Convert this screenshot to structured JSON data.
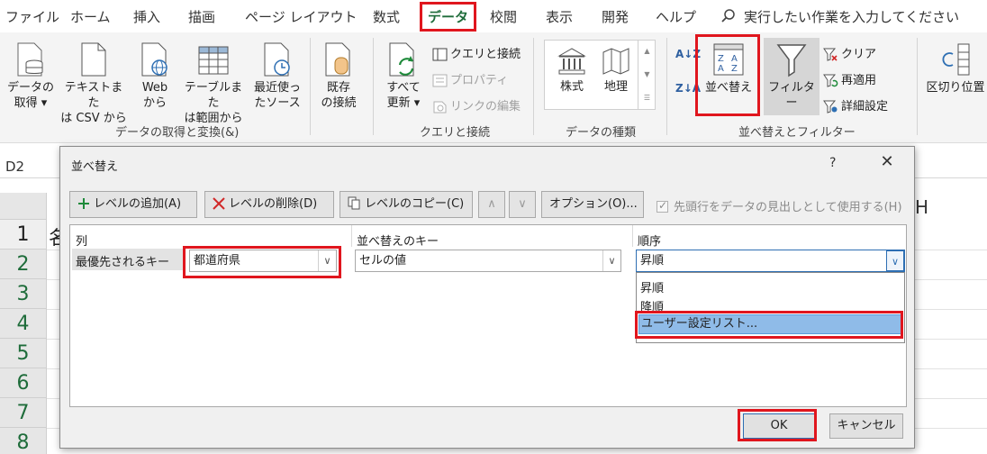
{
  "ribbon_tabs": [
    "ファイル",
    "ホーム",
    "挿入",
    "描画",
    "ページ レイアウト",
    "数式",
    "データ",
    "校閲",
    "表示",
    "開発",
    "ヘルプ"
  ],
  "tell_me": "実行したい作業を入力してください",
  "ribbon": {
    "get_data": {
      "get_data_label": "データの\n取得 ▾",
      "text_csv_label": "テキストまた\nは CSV から",
      "web_label": "Web\nから",
      "table_range_label": "テーブルまた\nは範囲から",
      "recent_label": "最近使っ\nたソース",
      "existing_label": "既存\nの接続",
      "group_label": "データの取得と変換(&)"
    },
    "queries": {
      "refresh_all_label": "すべて\n更新 ▾",
      "queries_connections": "クエリと接続",
      "properties": "プロパティ",
      "edit_links": "リンクの編集",
      "group_label": "クエリと接続"
    },
    "data_types": {
      "stocks": "株式",
      "geography": "地理",
      "group_label": "データの種類"
    },
    "sort_filter": {
      "az": "A↓Z",
      "za": "Z↓A",
      "sort_label": "並べ替え",
      "filter_label": "フィルター",
      "clear": "クリア",
      "reapply": "再適用",
      "advanced": "詳細設定",
      "group_label": "並べ替えとフィルター"
    },
    "text_to_columns": "区切り位置"
  },
  "name_box": "D2",
  "sheet": {
    "col_h": "H",
    "rows": [
      "1",
      "2",
      "3",
      "4",
      "5",
      "6",
      "7",
      "8"
    ],
    "row1_cell": "名"
  },
  "dialog": {
    "title": "並べ替え",
    "help": "?",
    "close": "✕",
    "toolbar": {
      "add_level": "レベルの追加(A)",
      "delete_level": "レベルの削除(D)",
      "copy_level": "レベルのコピー(C)",
      "up": "∧",
      "down": "∨",
      "options": "オプション(O)...",
      "header_checkbox": "先頭行をデータの見出しとして使用する(H)"
    },
    "headers": {
      "column": "列",
      "sort_on": "並べ替えのキー",
      "order": "順序"
    },
    "row": {
      "label": "最優先されるキー",
      "column_value": "都道府県",
      "sort_on_value": "セルの値",
      "order_value": "昇順"
    },
    "order_options": [
      "昇順",
      "降順",
      "ユーザー設定リスト..."
    ],
    "ok": "OK",
    "cancel": "キャンセル"
  },
  "colors": {
    "highlight": "#e0161e",
    "excel_green": "#1e6c3a",
    "selection_blue": "#8fbbe8"
  }
}
